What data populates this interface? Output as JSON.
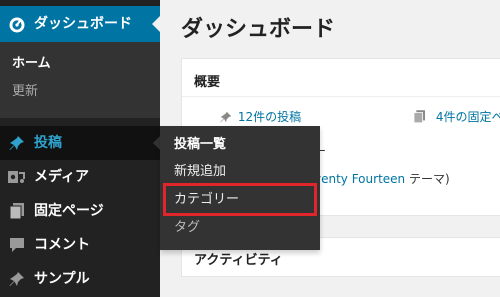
{
  "sidebar": {
    "dashboard": {
      "label": "ダッシュボード",
      "icon": "dashboard-gauge-icon"
    },
    "submenu": [
      {
        "label": "ホーム"
      },
      {
        "label": "更新"
      }
    ],
    "items": [
      {
        "label": "投稿",
        "icon": "pin-icon"
      },
      {
        "label": "メディア",
        "icon": "media-icon"
      },
      {
        "label": "固定ページ",
        "icon": "pages-icon"
      },
      {
        "label": "コメント",
        "icon": "comment-bubble-icon"
      },
      {
        "label": "サンプル",
        "icon": "pin-icon"
      }
    ]
  },
  "flyout": {
    "items": [
      {
        "label": "投稿一覧"
      },
      {
        "label": "新規追加"
      },
      {
        "label": "カテゴリー"
      },
      {
        "label": "タグ"
      }
    ],
    "highlight_color": "#e0262a"
  },
  "main": {
    "title": "ダッシュボード",
    "overview": {
      "title": "概要",
      "posts_link": "12件の投稿",
      "pages_link": "4件の固定ペ",
      "theme_fragment_arrow": "ー",
      "theme_name": "venty Fourteen",
      "theme_suffix": " テーマ)"
    },
    "activity": {
      "title": "アクティビティ"
    }
  },
  "colors": {
    "sidebar_bg": "#222222",
    "submenu_bg": "#333333",
    "accent_blue": "#0074a2",
    "link_blue": "#0074a2",
    "hover_text": "#2ea2cc"
  }
}
